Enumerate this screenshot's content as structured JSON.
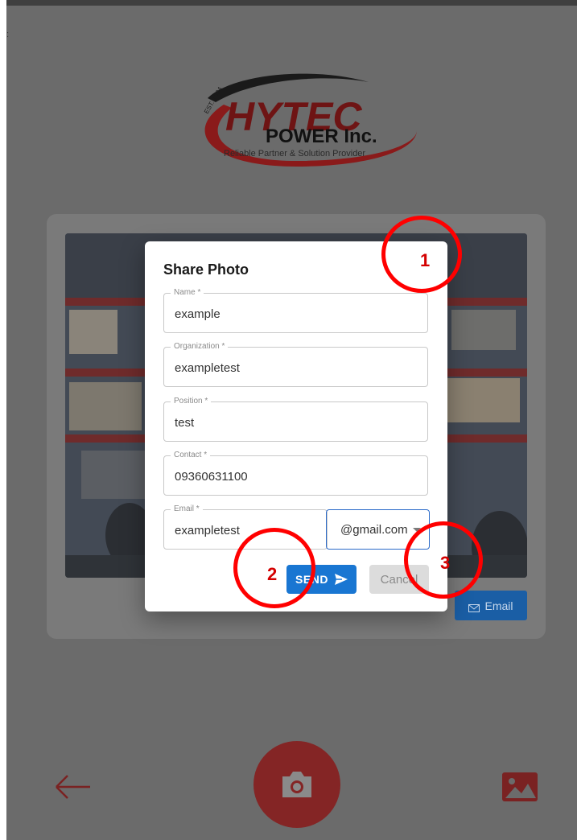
{
  "logo": {
    "brand": "HYTEC",
    "sub": "POWER Inc.",
    "est": "EST. 1994",
    "tagline": "Reliable Partner & Solution Provider"
  },
  "dialog": {
    "title": "Share Photo",
    "fields": {
      "name": {
        "label": "Name *",
        "value": "example"
      },
      "organization": {
        "label": "Organization *",
        "value": "exampletest"
      },
      "position": {
        "label": "Position *",
        "value": "test"
      },
      "contact": {
        "label": "Contact *",
        "value": "09360631100"
      },
      "email": {
        "label": "Email *",
        "value": "exampletest"
      }
    },
    "domain": {
      "selected": "@gmail.com"
    },
    "send_label": "SEND",
    "cancel_label": "Cancel"
  },
  "email_button": {
    "label": "Email"
  },
  "annotations": [
    "1",
    "2",
    "3"
  ],
  "icons": {
    "back": "arrow-left-icon",
    "camera": "camera-icon",
    "gallery": "image-icon",
    "send": "send-icon",
    "email": "mail-icon"
  },
  "colors": {
    "primary": "#1976d2",
    "brand_red": "#842525",
    "annotation": "#ff0000",
    "overlay": "#6b6b6b"
  }
}
